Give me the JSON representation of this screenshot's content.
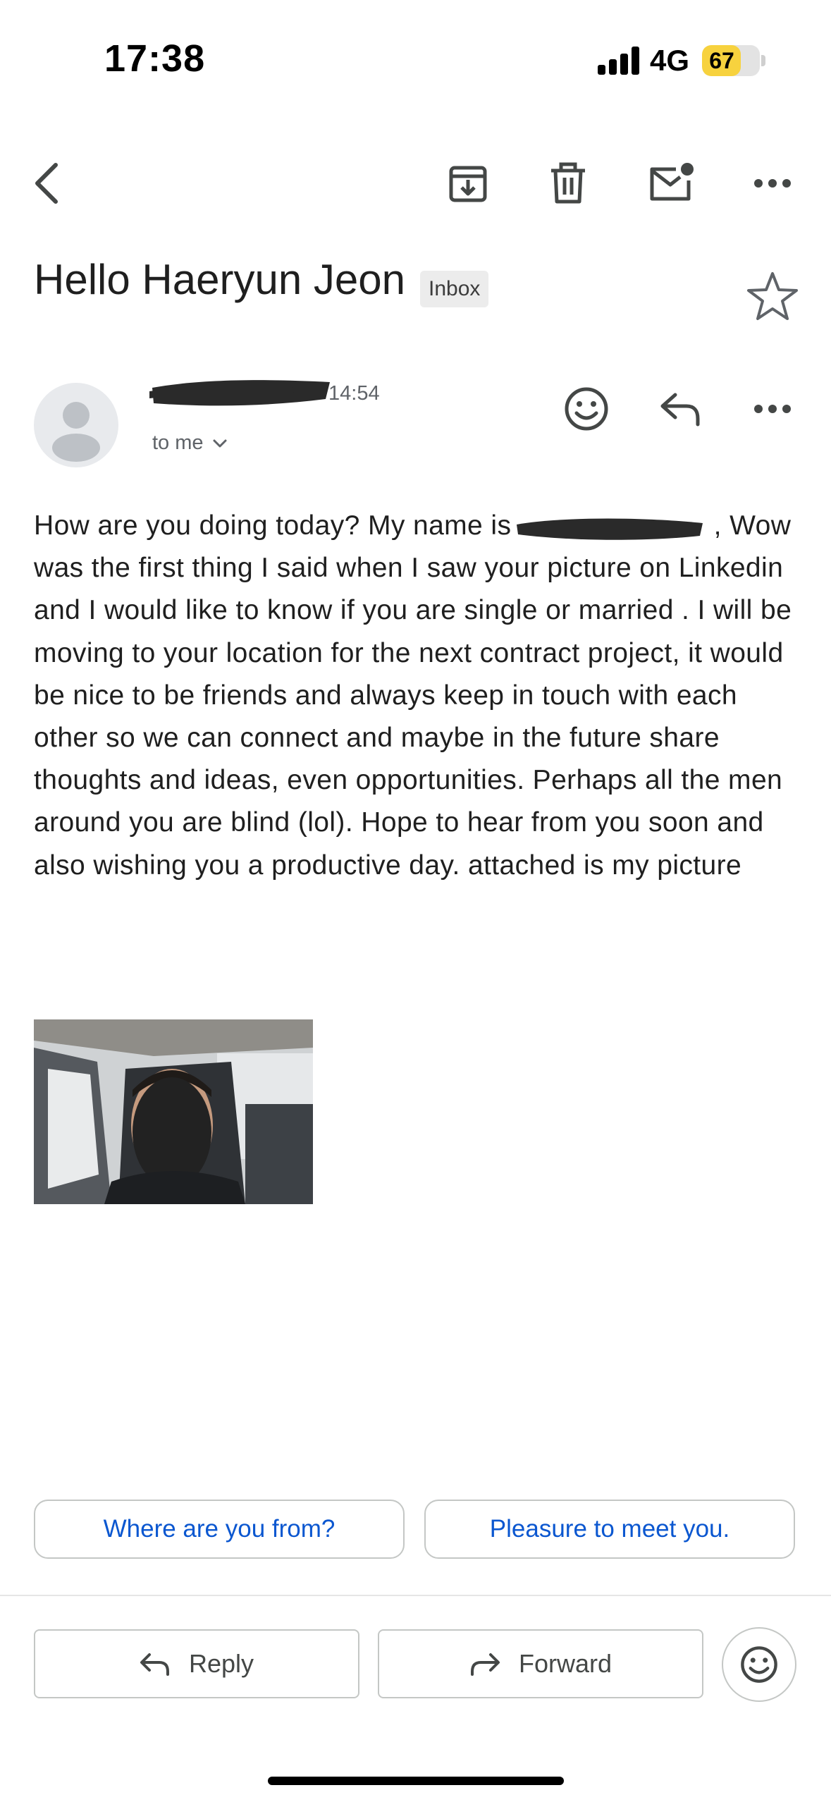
{
  "status_bar": {
    "time": "17:38",
    "network": "4G",
    "battery_percent": 67,
    "battery_label": "67",
    "battery_color": "#f7d23e"
  },
  "toolbar": {
    "back_icon": "chevron-left-icon",
    "archive_icon": "archive-icon",
    "delete_icon": "trash-icon",
    "mark_unread_icon": "mail-unread-icon",
    "more_icon": "more-horizontal-icon"
  },
  "email": {
    "subject": "Hello Haeryun Jeon",
    "label": "Inbox",
    "sender_time": "14:54",
    "recipient": "to me",
    "body_intro": "How are you doing today? My name is",
    "body_comma": ",",
    "body_main": "Wow was the first thing I said when I saw your picture on Linkedin and I would like to know if you are single or married . I will be moving to your location for the next contract project, it would be nice to be friends and always keep in touch with each other so we can connect and maybe in the future share thoughts and ideas, even opportunities. Perhaps all the men around you are blind (lol). Hope to hear from you soon and also wishing you a productive day. attached is my picture"
  },
  "smart_replies": [
    "Where are you from?",
    "Pleasure to meet you."
  ],
  "actions": {
    "reply": "Reply",
    "forward": "Forward"
  },
  "colors": {
    "link_blue": "#0b57d0",
    "border": "#c4c7c5",
    "redaction": "#2a2a2a"
  }
}
